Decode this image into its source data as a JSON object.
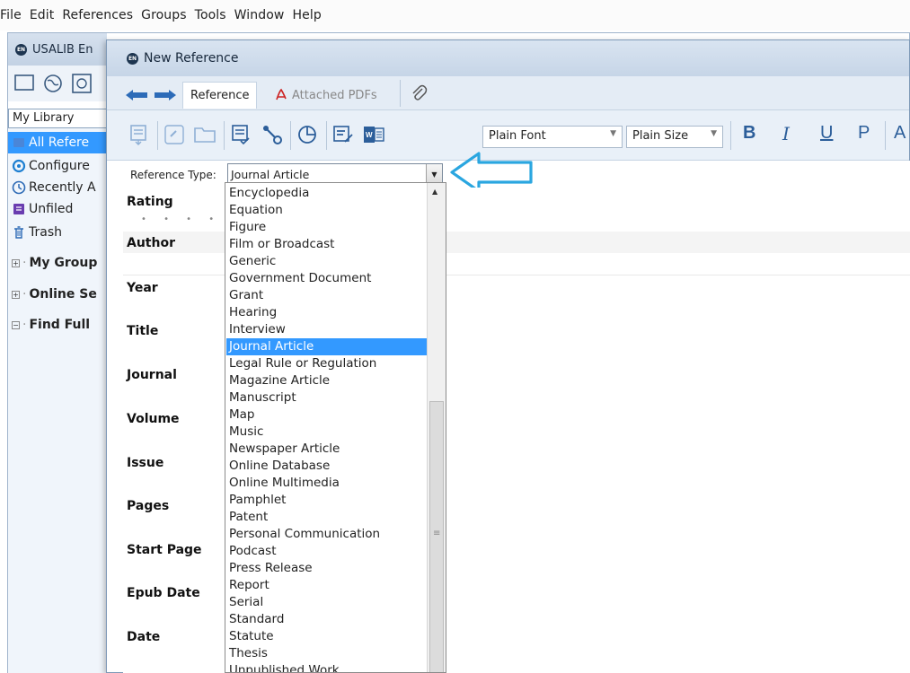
{
  "menu": [
    "File",
    "Edit",
    "References",
    "Groups",
    "Tools",
    "Window",
    "Help"
  ],
  "main_window": {
    "title": "USALIB En",
    "library_selector": "My Library",
    "sidebar": [
      {
        "label": "All Refere",
        "icon": "all-references-icon",
        "selected": true
      },
      {
        "label": "Configure",
        "icon": "sync-icon"
      },
      {
        "label": "Recently A",
        "icon": "clock-icon"
      },
      {
        "label": "Unfiled",
        "icon": "unfiled-icon"
      },
      {
        "label": "Trash",
        "icon": "trash-icon"
      }
    ],
    "groups": [
      "My Group",
      "Online Se",
      "Find Full"
    ]
  },
  "dialog": {
    "title": "New Reference",
    "tabs": {
      "reference": "Reference",
      "attached_pdfs": "Attached PDFs"
    },
    "toolbar": {
      "font": "Plain Font",
      "size": "Plain Size",
      "bold": "B",
      "italic": "I",
      "underline": "U",
      "plain": "P",
      "more": "A"
    },
    "reference_type": {
      "label": "Reference Type:",
      "value": "Journal Article"
    },
    "fields": [
      "Rating",
      "Author",
      "Year",
      "Title",
      "Journal",
      "Volume",
      "Issue",
      "Pages",
      "Start Page",
      "Epub Date",
      "Date"
    ],
    "dropdown_options": [
      "Encyclopedia",
      "Equation",
      "Figure",
      "Film or Broadcast",
      "Generic",
      "Government Document",
      "Grant",
      "Hearing",
      "Interview",
      "Journal Article",
      "Legal Rule or Regulation",
      "Magazine Article",
      "Manuscript",
      "Map",
      "Music",
      "Newspaper Article",
      "Online Database",
      "Online Multimedia",
      "Pamphlet",
      "Patent",
      "Personal Communication",
      "Podcast",
      "Press Release",
      "Report",
      "Serial",
      "Standard",
      "Statute",
      "Thesis",
      "Unpublished Work"
    ],
    "selected_option": "Journal Article"
  },
  "colors": {
    "selection": "#3399ff",
    "callout_arrow": "#2aa6e0",
    "title_gradient": "#c6d5e7"
  }
}
